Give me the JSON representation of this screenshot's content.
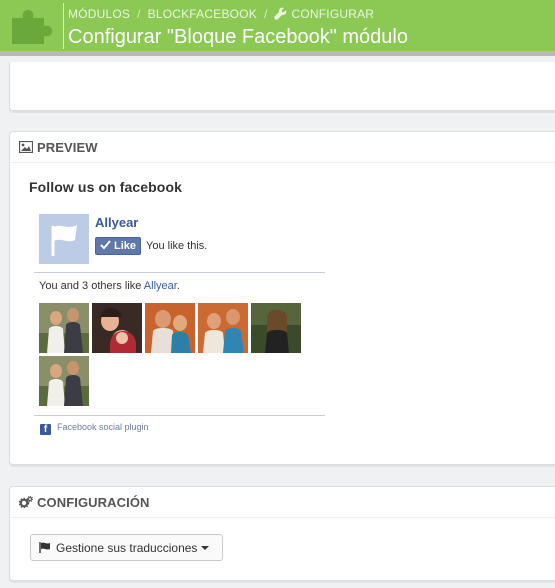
{
  "breadcrumb": {
    "items": [
      "MÓDULOS",
      "BLOCKFACEBOOK",
      "CONFIGURAR"
    ],
    "separator": "/"
  },
  "page_title": "Configurar \"Bloque Facebook\" módulo",
  "preview": {
    "heading": "PREVIEW",
    "follow_title": "Follow us on facebook",
    "page_name": "Allyear",
    "like_label": "Like",
    "you_like_text": "You like this.",
    "count_prefix": "You and 3 others like ",
    "count_link": "Allyear",
    "count_suffix": ".",
    "plugin_label": "Facebook social plugin",
    "fb_glyph": "f"
  },
  "config": {
    "heading": "CONFIGURACIÓN",
    "translations_button": "Gestione sus traducciones"
  },
  "colors": {
    "header_green": "#8bc954",
    "facebook_blue": "#3b5998",
    "like_button": "#5f78ab"
  },
  "icons": {
    "header": "puzzle-icon",
    "breadcrumb_configure": "wrench-icon",
    "preview_heading": "image-icon",
    "config_heading": "cogs-icon",
    "translations": "flag-icon"
  }
}
